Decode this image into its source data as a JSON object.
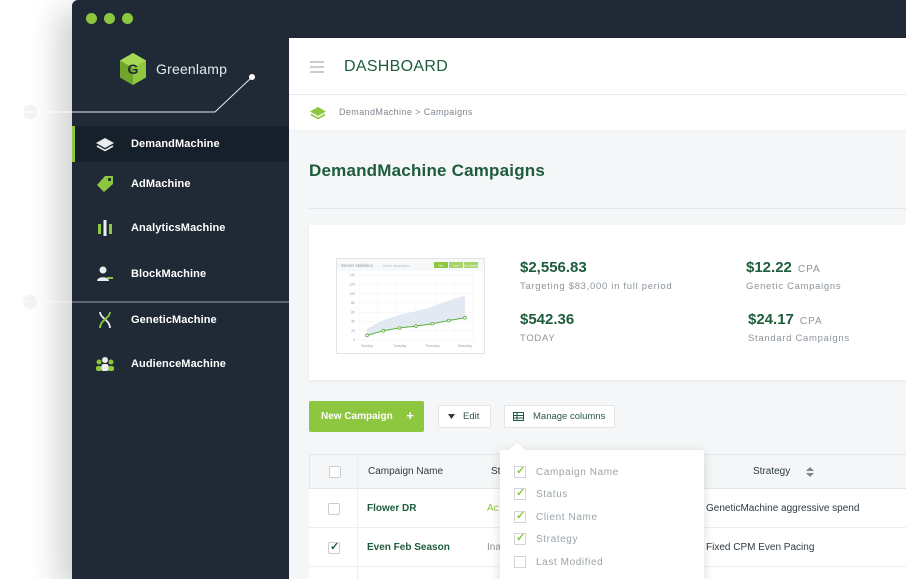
{
  "app": {
    "brand": "Greenlamp"
  },
  "header": {
    "title": "DASHBOARD"
  },
  "breadcrumb": "DemandMachine > Campaigns",
  "sidebar": {
    "items": [
      {
        "label": "DemandMachine",
        "icon": "layers-icon",
        "active": true
      },
      {
        "label": "AdMachine",
        "icon": "tag-icon"
      },
      {
        "label": "AnalyticsMachine",
        "icon": "bars-icon"
      },
      {
        "label": "BlockMachine",
        "icon": "user-block-icon"
      },
      {
        "label": "GeneticMachine",
        "icon": "dna-icon"
      },
      {
        "label": "AudienceMachine",
        "icon": "audience-icon"
      }
    ]
  },
  "page": {
    "title": "DemandMachine Campaigns"
  },
  "stats": [
    {
      "value": "$2,556.83",
      "unit": "",
      "sub": "Targeting $83,000 in full period"
    },
    {
      "value": "$542.36",
      "unit": "",
      "sub": "TODAY"
    },
    {
      "value": "$12.22",
      "unit": "CPA",
      "sub": "Genetic Campaigns"
    },
    {
      "value": "$24.17",
      "unit": "CPA",
      "sub": "Standard Campaigns"
    }
  ],
  "mini_chart": {
    "title": "Server statistics",
    "subtitle": "Some description",
    "tabs": [
      "Hot",
      "Live",
      "Cumulative"
    ],
    "y_ticks": [
      "140",
      "120",
      "100",
      "80",
      "60",
      "40",
      "20",
      "0"
    ],
    "x_labels": [
      "Sunday",
      "Tuesday",
      "Thursday",
      "Saturday"
    ]
  },
  "chart_data": {
    "type": "line",
    "title": "Server statistics",
    "x": [
      1,
      2,
      3,
      4,
      5,
      6,
      7
    ],
    "series": [
      {
        "values": [
          10,
          20,
          26,
          30,
          35,
          42,
          48
        ]
      }
    ],
    "ylim": [
      0,
      140
    ]
  },
  "toolbar": {
    "new_campaign": "New Campaign",
    "new_plus": "+",
    "edit": "Edit",
    "manage_columns": "Manage columns"
  },
  "table": {
    "headers": {
      "name": "Campaign Name",
      "status": "St",
      "strategy": "Strategy"
    },
    "rows": [
      {
        "name": "Flower DR",
        "status": "Ac",
        "strategy": "GeneticMachine aggressive spend",
        "checked": false
      },
      {
        "name": "Even Feb Season",
        "status": "Ina",
        "strategy": "Fixed CPM Even Pacing",
        "checked": true
      }
    ]
  },
  "columns_menu": [
    {
      "label": "Campaign Name",
      "checked": true
    },
    {
      "label": "Status",
      "checked": true
    },
    {
      "label": "Client Name",
      "checked": true
    },
    {
      "label": "Strategy",
      "checked": true
    },
    {
      "label": "Last Modified",
      "checked": false
    }
  ],
  "colors": {
    "accent": "#8dc63f",
    "brand_dark": "#1d5c3c",
    "sidebar": "#1f2a36"
  }
}
